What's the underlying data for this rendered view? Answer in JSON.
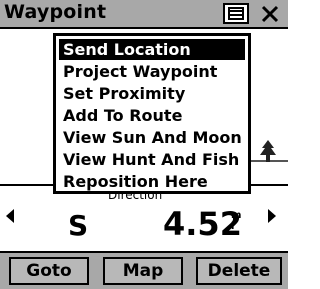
{
  "title": "Waypoint",
  "colors": {
    "title_bar": "#a8a8a8",
    "selection": "#000000",
    "button_face": "#b8b8b8"
  },
  "icons": {
    "menu": "menu-icon",
    "close": "close-icon",
    "left": "left-arrow-icon",
    "right": "right-arrow-icon",
    "tree": "tree-icon"
  },
  "menu": {
    "items": [
      {
        "label": "Send Location",
        "selected": true
      },
      {
        "label": "Project Waypoint",
        "selected": false
      },
      {
        "label": "Set Proximity",
        "selected": false
      },
      {
        "label": "Add To Route",
        "selected": false
      },
      {
        "label": "View Sun And Moon",
        "selected": false
      },
      {
        "label": "View Hunt And Fish",
        "selected": false
      },
      {
        "label": "Reposition Here",
        "selected": false
      }
    ]
  },
  "info": {
    "direction_label": "Direction",
    "direction_value": "S",
    "distance_value": "4.52",
    "distance_unit_top": "m",
    "distance_unit_bottom": "i"
  },
  "buttons": {
    "goto": "Goto",
    "map": "Map",
    "delete": "Delete"
  }
}
